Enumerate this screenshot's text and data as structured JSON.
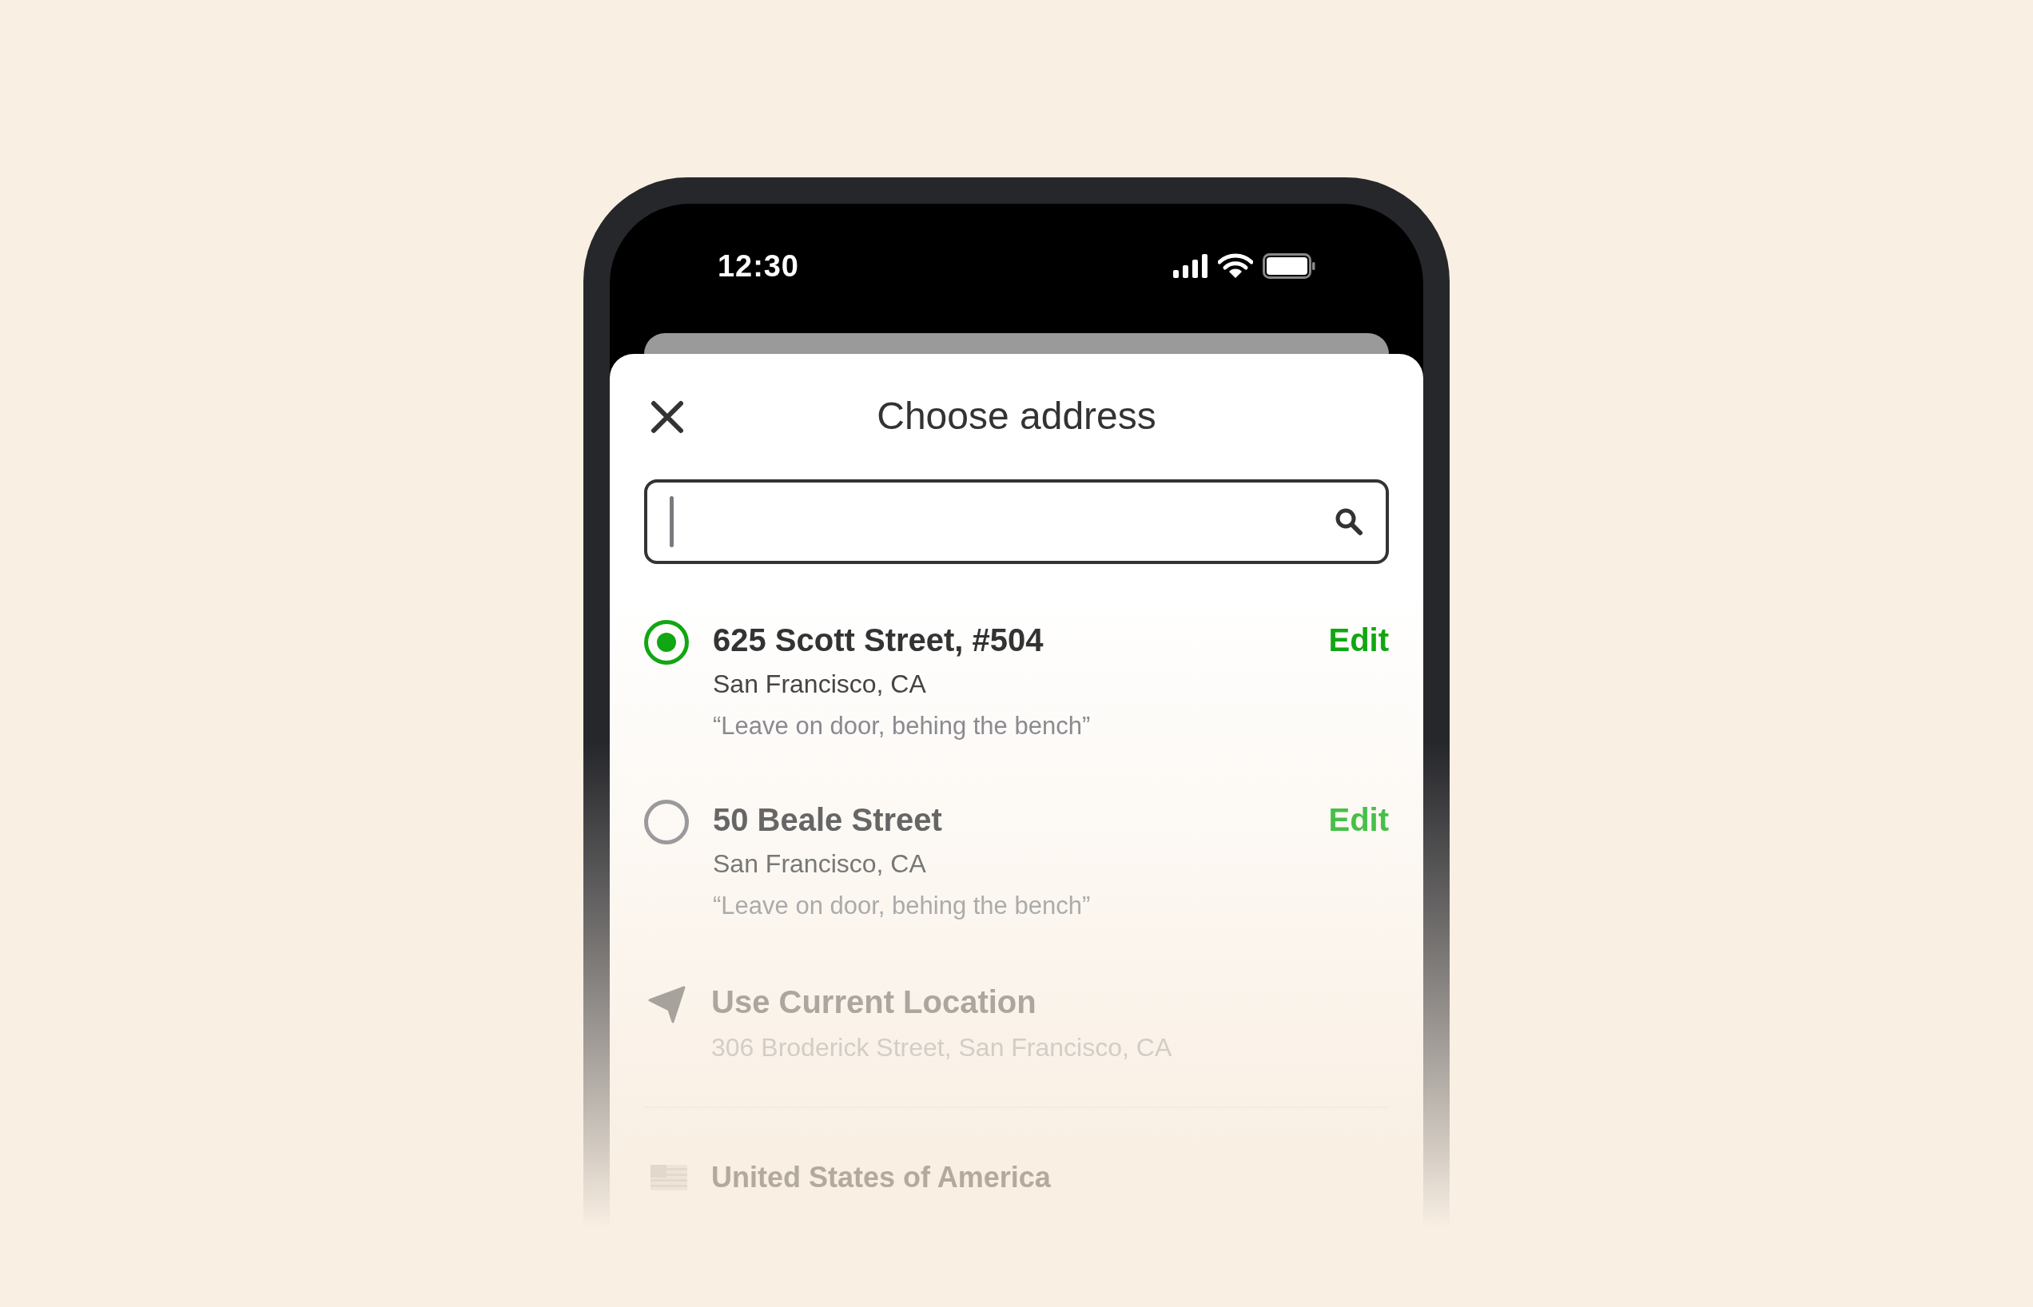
{
  "status_bar": {
    "time": "12:30"
  },
  "sheet": {
    "title": "Choose address"
  },
  "search": {
    "focused": true
  },
  "addresses": [
    {
      "title": "625 Scott Street, #504",
      "city": "San Francisco, CA",
      "note": "“Leave on door, behing the bench”",
      "edit": "Edit",
      "selected": true
    },
    {
      "title": "50 Beale Street",
      "city": "San Francisco, CA",
      "note": "“Leave on door, behing the bench”",
      "edit": "Edit",
      "selected": false
    }
  ],
  "current_location": {
    "label": "Use Current Location",
    "address": "306 Broderick Street, San Francisco, CA"
  },
  "country": {
    "name": "United States of America"
  }
}
